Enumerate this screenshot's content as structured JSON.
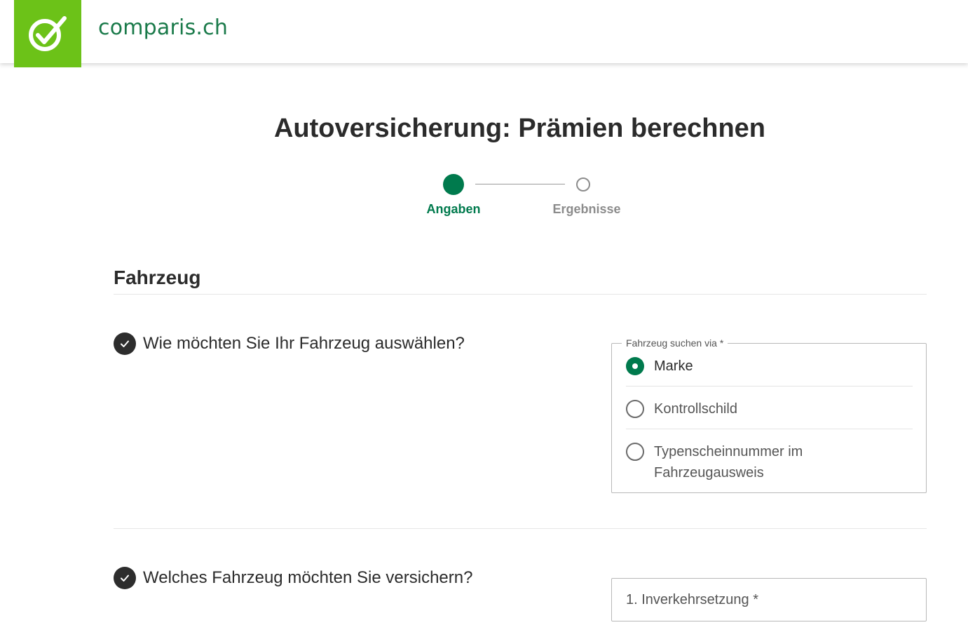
{
  "header": {
    "brand": "comparis.ch",
    "logo_icon": "checkmark-circle-icon",
    "brand_color": "#6cc218"
  },
  "page": {
    "title": "Autoversicherung: Prämien berechnen",
    "accent_color": "#007a4d"
  },
  "stepper": {
    "steps": [
      {
        "label": "Angaben",
        "state": "active"
      },
      {
        "label": "Ergebnisse",
        "state": "inactive"
      }
    ]
  },
  "section": {
    "title": "Fahrzeug"
  },
  "questions": [
    {
      "text": "Wie möchten Sie Ihr Fahrzeug auswählen?",
      "icon": "check-icon",
      "field": {
        "legend": "Fahrzeug suchen via *",
        "options": [
          {
            "label": "Marke",
            "selected": true
          },
          {
            "label": "Kontrollschild",
            "selected": false
          },
          {
            "label": "Typenscheinnummer im Fahrzeugausweis",
            "selected": false
          }
        ]
      }
    },
    {
      "text": "Welches Fahrzeug möchten Sie versichern?",
      "icon": "check-icon",
      "field": {
        "placeholder": "1. Inverkehrsetzung *"
      }
    }
  ]
}
